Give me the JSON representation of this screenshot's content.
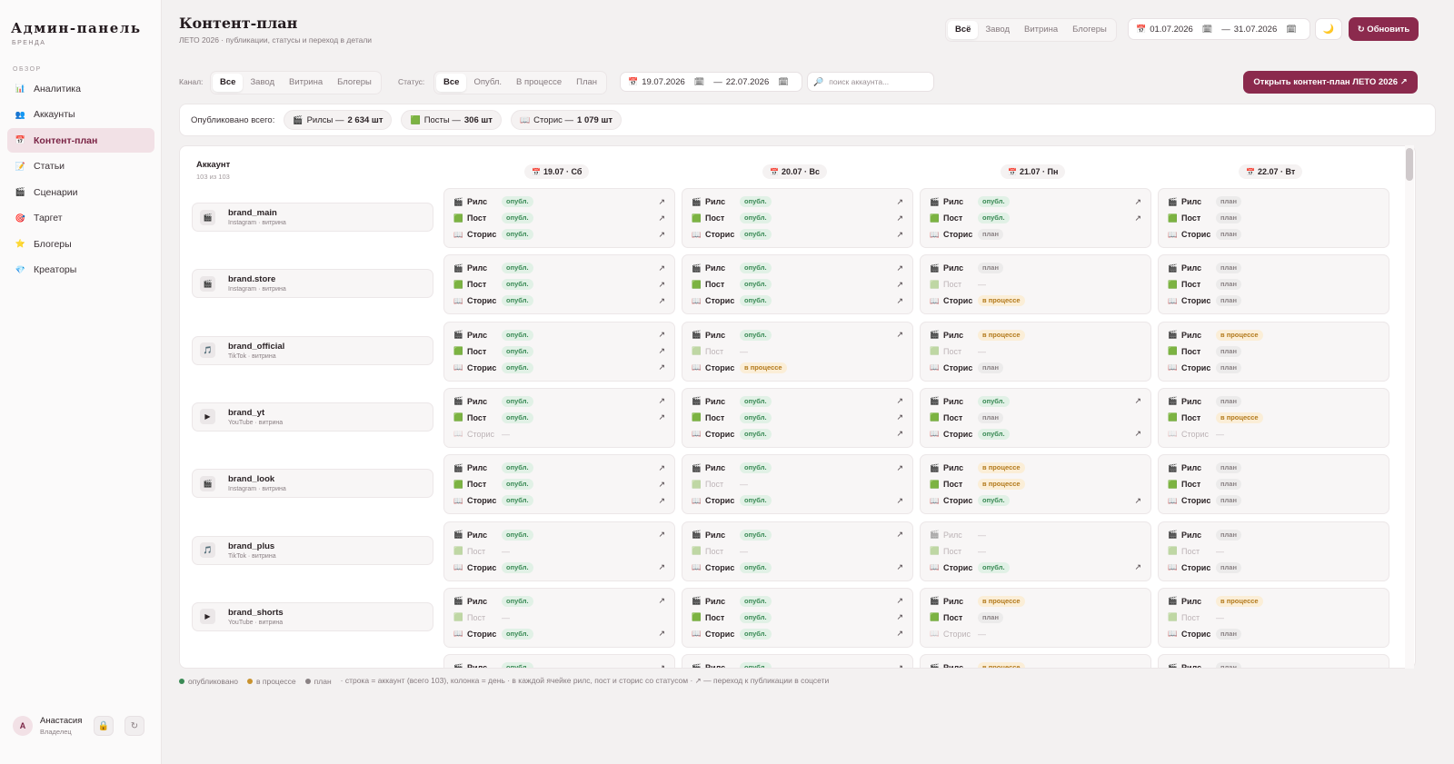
{
  "sidebar": {
    "brand": "Админ-панель",
    "brand_sub": "БРЕНДА",
    "section": "ОБЗОР",
    "items": [
      {
        "label": "Аналитика",
        "icon": "📊",
        "name": "analytics"
      },
      {
        "label": "Аккаунты",
        "icon": "👥",
        "name": "accounts"
      },
      {
        "label": "Контент-план",
        "icon": "📅",
        "name": "content-plan"
      },
      {
        "label": "Статьи",
        "icon": "📝",
        "name": "articles"
      },
      {
        "label": "Сценарии",
        "icon": "🎬",
        "name": "scenarios"
      },
      {
        "label": "Таргет",
        "icon": "🎯",
        "name": "target"
      },
      {
        "label": "Блогеры",
        "icon": "⭐",
        "name": "bloggers"
      },
      {
        "label": "Креаторы",
        "icon": "💎",
        "name": "creators"
      }
    ],
    "active_index": 2,
    "user": {
      "initial": "А",
      "name": "Анастасия",
      "role": "Владелец",
      "lock_icon": "🔒",
      "logout_icon": "↻"
    }
  },
  "header": {
    "title": "Контент-план",
    "subtitle": "ЛЕТО 2026 · публикации, статусы и переход в детали",
    "scope_tabs": [
      "Всё",
      "Завод",
      "Витрина",
      "Блогеры"
    ],
    "scope_active": 0,
    "date_from": "01.07.2026",
    "date_to": "31.07.2026",
    "range_sep": "—",
    "theme_icon": "🌙",
    "refresh_label": "↻ Обновить"
  },
  "filters": {
    "channel_label": "Канал:",
    "channel_tabs": [
      "Все",
      "Завод",
      "Витрина",
      "Блогеры"
    ],
    "channel_active": 0,
    "status_label": "Статус:",
    "status_tabs": [
      "Все",
      "Опубл.",
      "В процессе",
      "План"
    ],
    "status_active": 0,
    "date_from": "19.07.2026",
    "date_to": "22.07.2026",
    "range_sep": "—",
    "search_placeholder": "поиск аккаунта...",
    "open_plan_label": "Открыть контент-план ЛЕТО 2026 ↗"
  },
  "totals": {
    "label": "Опубликовано всего:",
    "items": [
      {
        "icon": "🎬",
        "label": "Рилсы —",
        "value": "2 634 шт"
      },
      {
        "icon": "🟩",
        "label": "Посты —",
        "value": "306 шт"
      },
      {
        "icon": "📖",
        "label": "Сторис —",
        "value": "1 079 шт"
      }
    ]
  },
  "grid": {
    "account_header": "Аккаунт",
    "account_count": "103 из 103",
    "days": [
      "19.07 · Сб",
      "20.07 · Вс",
      "21.07 · Пн",
      "22.07 · Вт"
    ],
    "day_icon": "📅",
    "types": [
      {
        "label": "Рилс",
        "icon": "🎬"
      },
      {
        "label": "Пост",
        "icon": "🟩"
      },
      {
        "label": "Сторис",
        "icon": "📖"
      }
    ],
    "status_labels": {
      "pub": "опубл.",
      "prog": "в процессе",
      "plan": "план",
      "none": "—"
    },
    "arrow": "↗",
    "accounts": [
      {
        "name": "brand_main",
        "meta": "Instagram · витрина",
        "icon": "🎬",
        "cells": [
          [
            "pub",
            "pub",
            "pub"
          ],
          [
            "pub",
            "pub",
            "pub"
          ],
          [
            "pub",
            "pub",
            "plan"
          ],
          [
            "plan",
            "plan",
            "plan"
          ]
        ]
      },
      {
        "name": "brand.store",
        "meta": "Instagram · витрина",
        "icon": "🎬",
        "cells": [
          [
            "pub",
            "pub",
            "pub"
          ],
          [
            "pub",
            "pub",
            "pub"
          ],
          [
            "plan",
            "none",
            "prog"
          ],
          [
            "plan",
            "plan",
            "plan"
          ]
        ]
      },
      {
        "name": "brand_official",
        "meta": "TikTok · витрина",
        "icon": "🎵",
        "cells": [
          [
            "pub",
            "pub",
            "pub"
          ],
          [
            "pub",
            "none",
            "prog"
          ],
          [
            "prog",
            "none",
            "plan"
          ],
          [
            "prog",
            "plan",
            "plan"
          ]
        ]
      },
      {
        "name": "brand_yt",
        "meta": "YouTube · витрина",
        "icon": "▶",
        "cells": [
          [
            "pub",
            "pub",
            "none"
          ],
          [
            "pub",
            "pub",
            "pub"
          ],
          [
            "pub",
            "plan",
            "pub"
          ],
          [
            "plan",
            "prog",
            "none"
          ]
        ]
      },
      {
        "name": "brand_look",
        "meta": "Instagram · витрина",
        "icon": "🎬",
        "cells": [
          [
            "pub",
            "pub",
            "pub"
          ],
          [
            "pub",
            "none",
            "pub"
          ],
          [
            "prog",
            "prog",
            "pub"
          ],
          [
            "plan",
            "plan",
            "plan"
          ]
        ]
      },
      {
        "name": "brand_plus",
        "meta": "TikTok · витрина",
        "icon": "🎵",
        "cells": [
          [
            "pub",
            "none",
            "pub"
          ],
          [
            "pub",
            "none",
            "pub"
          ],
          [
            "none",
            "none",
            "pub"
          ],
          [
            "plan",
            "none",
            "plan"
          ]
        ]
      },
      {
        "name": "brand_shorts",
        "meta": "YouTube · витрина",
        "icon": "▶",
        "cells": [
          [
            "pub",
            "none",
            "pub"
          ],
          [
            "pub",
            "pub",
            "pub"
          ],
          [
            "prog",
            "plan",
            "none"
          ],
          [
            "prog",
            "none",
            "plan"
          ]
        ]
      }
    ],
    "partial_row": [
      "pub",
      "pub",
      "prog",
      "plan"
    ]
  },
  "legend": {
    "items": [
      {
        "label": "опубликовано",
        "color": "#3a8a55"
      },
      {
        "label": "в процессе",
        "color": "#c9932f"
      },
      {
        "label": "план",
        "color": "#8a8284"
      }
    ],
    "note": "· строка = аккаунт (всего 103), колонка = день · в каждой ячейке рилс, пост и сторис со статусом · ↗ — переход к публикации в соцсети"
  }
}
